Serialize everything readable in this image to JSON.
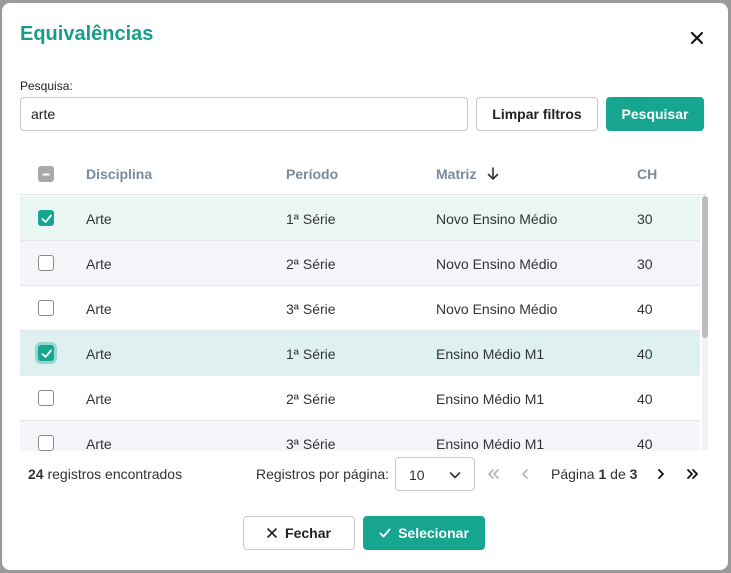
{
  "dialog": {
    "title": "Equivalências",
    "close_icon": "close-icon"
  },
  "search": {
    "label": "Pesquisa:",
    "value": "arte",
    "clear_label": "Limpar filtros",
    "submit_label": "Pesquisar"
  },
  "table": {
    "columns": [
      "Disciplina",
      "Período",
      "Matriz",
      "CH"
    ],
    "sort_column": "Matriz",
    "sort_direction": "desc",
    "rows": [
      {
        "selected": true,
        "disciplina": "Arte",
        "periodo": "1ª Série",
        "matriz": "Novo Ensino Médio",
        "ch": "30"
      },
      {
        "selected": false,
        "disciplina": "Arte",
        "periodo": "2ª Série",
        "matriz": "Novo Ensino Médio",
        "ch": "30"
      },
      {
        "selected": false,
        "disciplina": "Arte",
        "periodo": "3ª Série",
        "matriz": "Novo Ensino Médio",
        "ch": "40"
      },
      {
        "selected": true,
        "disciplina": "Arte",
        "periodo": "1ª Série",
        "matriz": "Ensino Médio M1",
        "ch": "40"
      },
      {
        "selected": false,
        "disciplina": "Arte",
        "periodo": "2ª Série",
        "matriz": "Ensino Médio M1",
        "ch": "40"
      },
      {
        "selected": false,
        "disciplina": "Arte",
        "periodo": "3ª Série",
        "matriz": "Ensino Médio M1",
        "ch": "40"
      }
    ]
  },
  "pagination": {
    "total_count": "24",
    "count_suffix": " registros encontrados",
    "per_page_label": "Registros por página:",
    "per_page_value": "10",
    "page_prefix": "Página ",
    "current_page": "1",
    "page_sep": " de ",
    "total_pages": "3"
  },
  "actions": {
    "close_label": "Fechar",
    "select_label": "Selecionar"
  },
  "colors": {
    "accent": "#16a58f",
    "title": "#1a9c8a",
    "row_selected_bg": "#eaf6f4",
    "row_focus_bg": "#dff0f1",
    "row_alt_bg": "#f3f5f8"
  }
}
